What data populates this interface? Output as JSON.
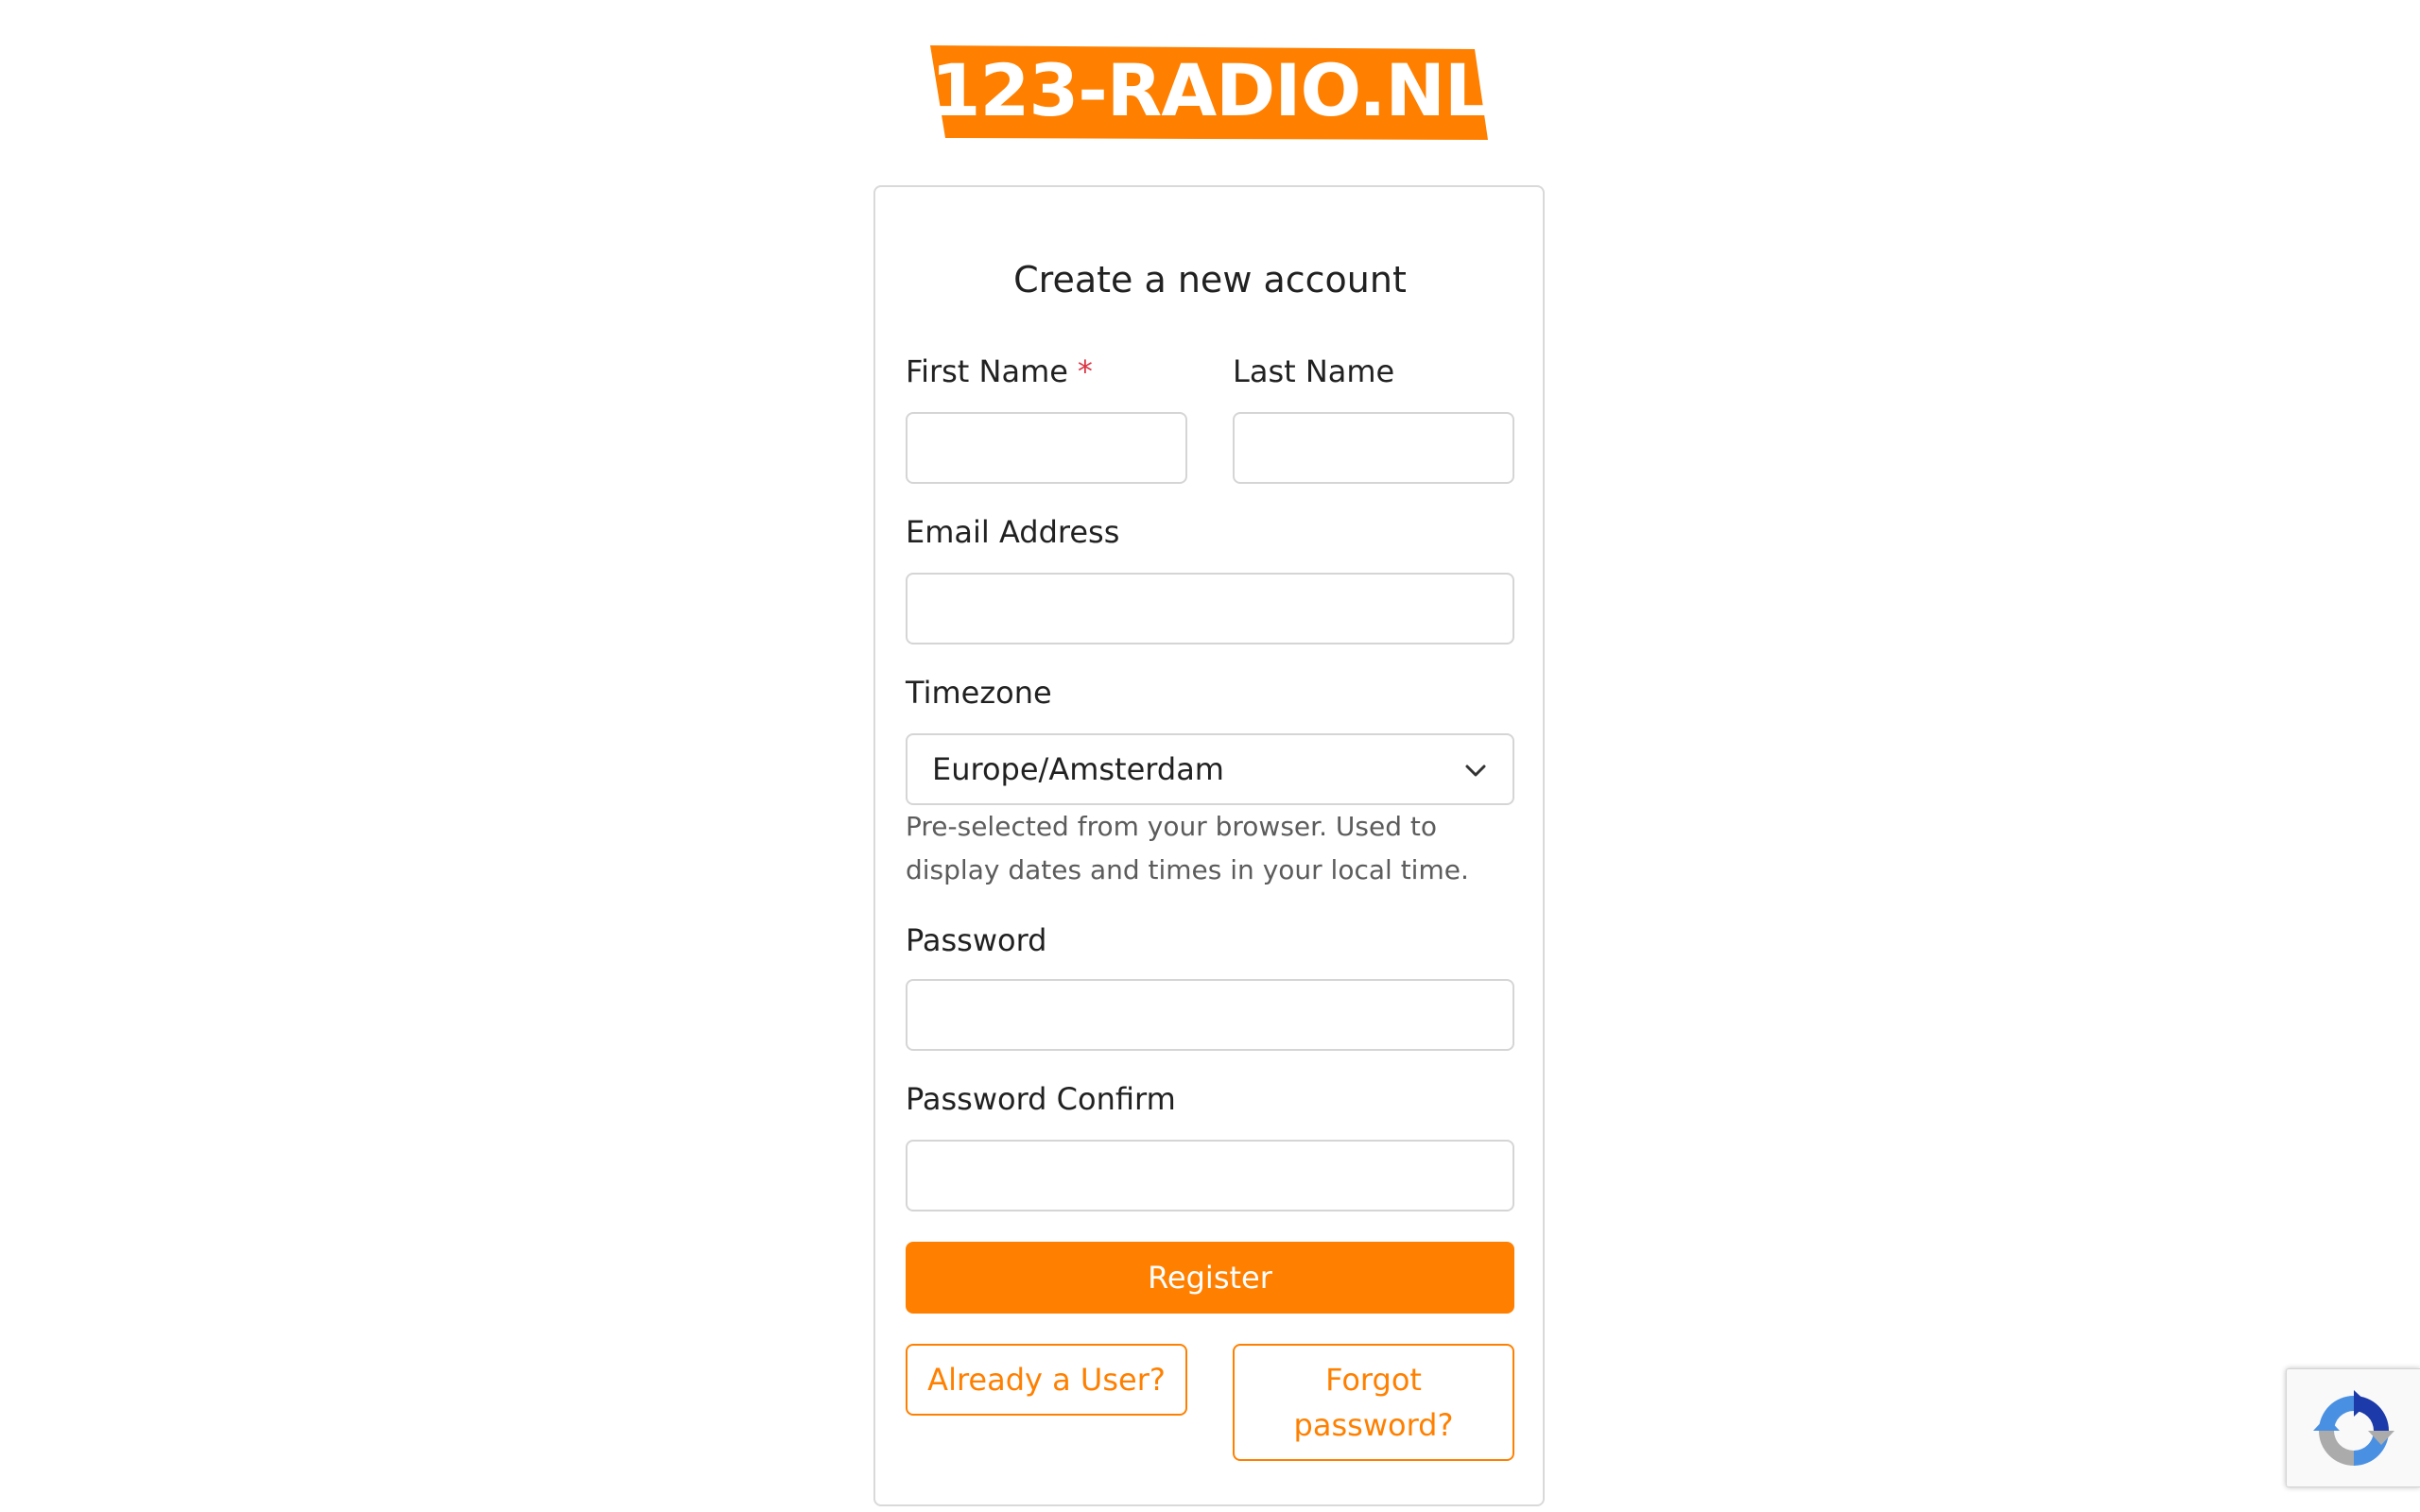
{
  "brand": {
    "logo_text": "123-RADIO.NL",
    "accent_color": "#ff8000"
  },
  "form": {
    "title": "Create a new account",
    "first_name": {
      "label": "First Name",
      "required_mark": "*",
      "value": ""
    },
    "last_name": {
      "label": "Last Name",
      "value": ""
    },
    "email": {
      "label": "Email Address",
      "value": ""
    },
    "timezone": {
      "label": "Timezone",
      "selected": "Europe/Amsterdam",
      "help": "Pre-selected from your browser. Used to display dates and times in your local time."
    },
    "password": {
      "label": "Password",
      "value": ""
    },
    "password_confirm": {
      "label": "Password Confirm",
      "value": ""
    },
    "register_label": "Register",
    "already_user_label": "Already a User?",
    "forgot_password_label": "Forgot password?"
  },
  "recaptcha": {
    "icon": "recaptcha-icon"
  }
}
